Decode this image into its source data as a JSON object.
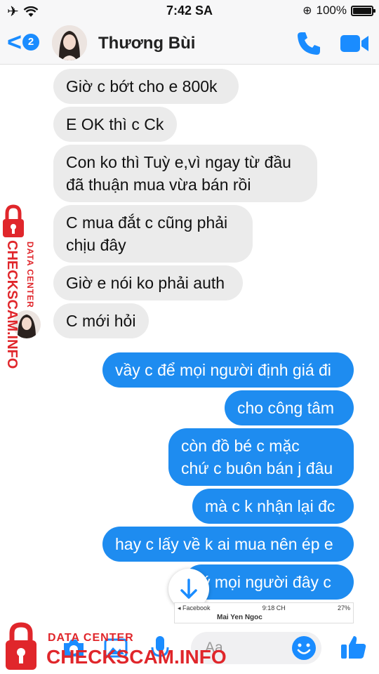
{
  "status_bar": {
    "time": "7:42 SA",
    "battery": "100%"
  },
  "header": {
    "back_count": "2",
    "contact_name": "Thương Bùi"
  },
  "messages": {
    "m1": "Giờ c bớt cho e 800k",
    "m2": "E OK thì c Ck",
    "m3_l1": "Con ko thì Tuỳ e,vì ngay từ đầu",
    "m3_l2": "đã thuận mua vừa bán rồi",
    "m4_l1": "C mua đắt c cũng phải",
    "m4_l2": "chịu đây",
    "m5": "Giờ e nói ko phải auth",
    "m6": "C mới hỏi",
    "o1": "vầy c để mọi người định giá đi",
    "o2": "cho công tâm",
    "o3_l1": "còn đồ bé c mặc",
    "o3_l2": "chứ c buôn bán j đâu",
    "o4": "mà c k nhận lại đc",
    "o5": "hay c lấy về k ai mua nên ép e",
    "o6": "ý mọi người đây c"
  },
  "mini_preview": {
    "app": "◂ Facebook",
    "time": "9:18 CH",
    "battery": "27%",
    "name": "Mai Yen Ngoc"
  },
  "composer": {
    "placeholder": "Aa"
  },
  "watermark": {
    "vertical_small": "DATA CENTER",
    "vertical_big": "CHECKSCAM.INFO",
    "bottom_small": "DATA CENTER",
    "bottom_big": "CHECKSCAM.INFO",
    "color": "#e0262b"
  },
  "colors": {
    "accent": "#1a8cff",
    "outgoing": "#1e8cf0",
    "incoming": "#ebebeb"
  }
}
